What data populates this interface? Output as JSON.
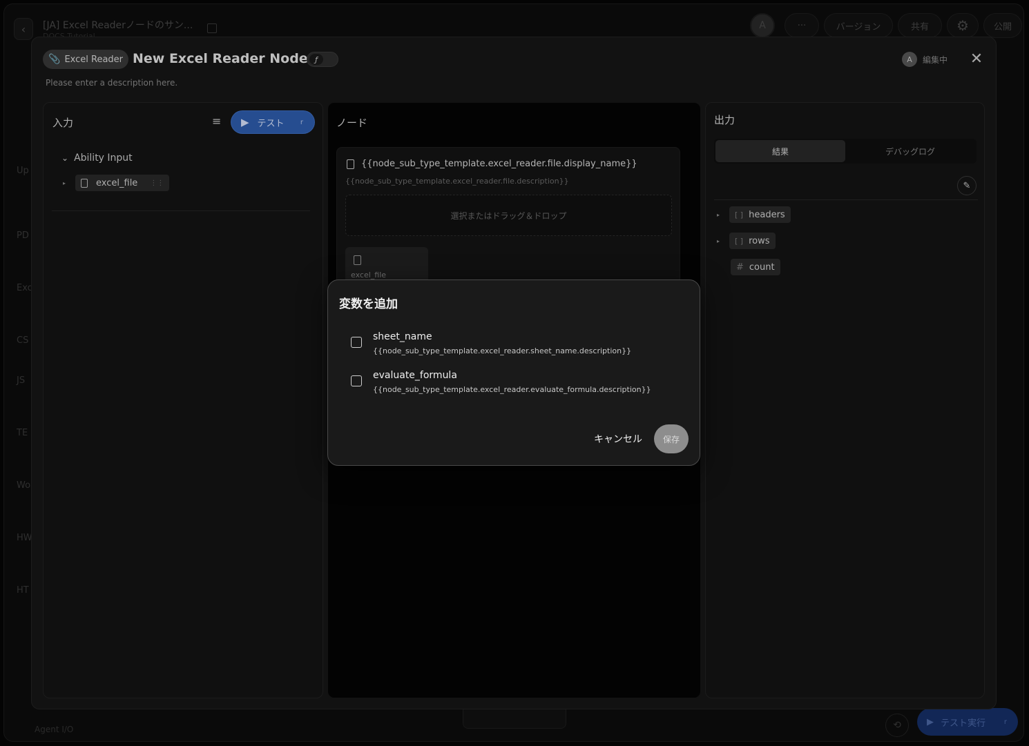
{
  "app": {
    "window_title": "[JA] Excel Readerノードのサン...",
    "window_subtitle": "DOCS Tutorial",
    "avatar_letter": "A",
    "more_label": "···",
    "version_label": "バージョン",
    "share_label": "共有",
    "publish_label": "公開",
    "left_items": [
      "Up",
      "PD",
      "Exc",
      "CS",
      "JS",
      "TE",
      "Wo",
      "HW",
      "HT"
    ],
    "agent_io_label": "Agent I/O",
    "bottom_test_run_label": "テスト実行",
    "bottom_test_run_kbd": "r"
  },
  "node_modal": {
    "badge_label": "Excel Reader",
    "title": "New Excel Reader Node 1",
    "toggle_symbol": "ƒ",
    "description": "Please enter a description here.",
    "editing_avatar": "A",
    "editing_label": "編集中",
    "close_symbol": "✕"
  },
  "input_panel": {
    "title": "入力",
    "test_button_label": "テスト",
    "test_button_kbd": "r",
    "group_label": "Ability Input",
    "field_label": "excel_file"
  },
  "node_panel": {
    "title": "ノード",
    "file_display_name": "{{node_sub_type_template.excel_reader.file.display_name}}",
    "file_description": "{{node_sub_type_template.excel_reader.file.description}}",
    "drop_label": "選択またはドラッグ＆ドロップ",
    "file_chip_label": "excel_file"
  },
  "output_panel": {
    "title": "出力",
    "tabs": [
      "結果",
      "デバッグログ"
    ],
    "fields": [
      {
        "label": "headers",
        "type_icon": "[ ]"
      },
      {
        "label": "rows",
        "type_icon": "[ ]"
      },
      {
        "label": "count",
        "type_icon": "#"
      }
    ]
  },
  "add_variable_dialog": {
    "title": "変数を追加",
    "options": [
      {
        "name": "sheet_name",
        "description": "{{node_sub_type_template.excel_reader.sheet_name.description}}"
      },
      {
        "name": "evaluate_formula",
        "description": "{{node_sub_type_template.excel_reader.evaluate_formula.description}}"
      }
    ],
    "cancel_label": "キャンセル",
    "save_label": "保存"
  }
}
